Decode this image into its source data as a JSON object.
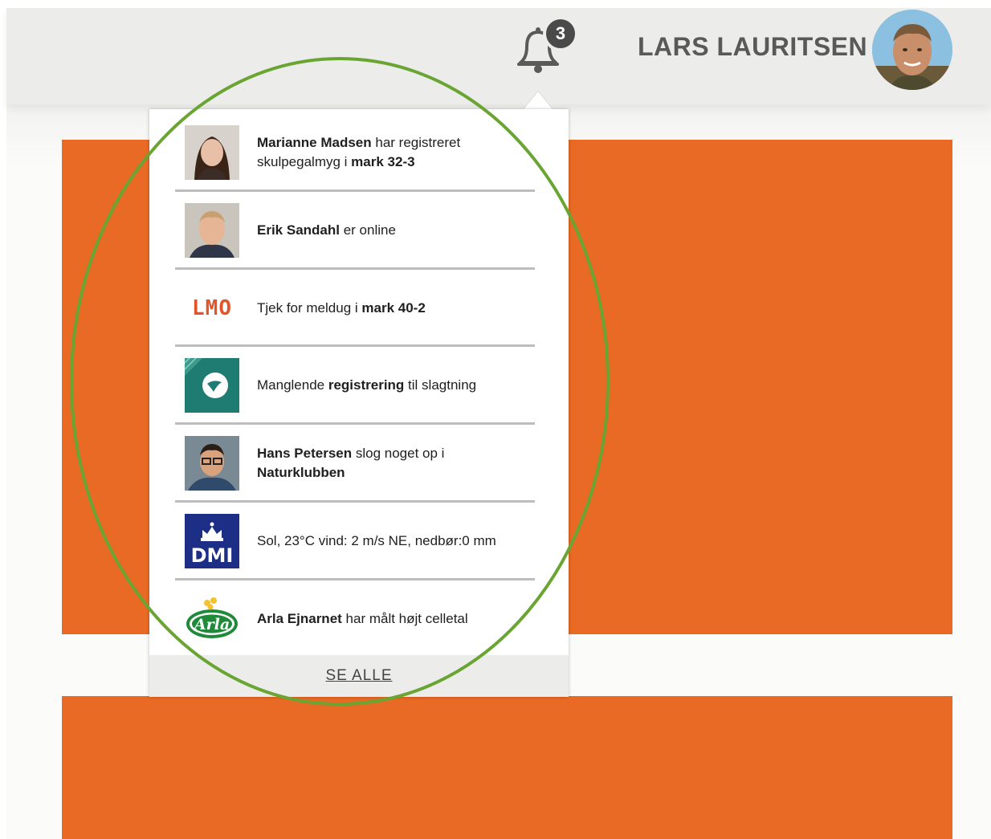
{
  "header": {
    "notification_count": "3",
    "user_name": "LARS LAURITSEN"
  },
  "notifications": [
    {
      "avatar": "woman-portrait",
      "name": "Marianne Madsen",
      "text_1": " har registreret skulpegalmyg i ",
      "bold_2": "mark 32-3",
      "text_2": ""
    },
    {
      "avatar": "man-portrait",
      "name": "Erik Sandahl",
      "text_1": " er online",
      "bold_2": "",
      "text_2": ""
    },
    {
      "avatar": "lmo-logo",
      "logo_text": "LMO",
      "name": "",
      "text_1": "Tjek for meldug i ",
      "bold_2": "mark 40-2",
      "text_2": ""
    },
    {
      "avatar": "seges-logo",
      "name": "",
      "text_1": "Manglende ",
      "bold_2": "registrering",
      "text_2": " til slagtning"
    },
    {
      "avatar": "man-glasses-portrait",
      "name": "Hans Petersen",
      "text_1": " slog noget op i ",
      "bold_2": "Naturklubben",
      "text_2": ""
    },
    {
      "avatar": "dmi-logo",
      "logo_text": "DMI",
      "name": "",
      "text_1": "Sol, 23°C vind: 2 m/s NE, nedbør:0 mm",
      "bold_2": "",
      "text_2": ""
    },
    {
      "avatar": "arla-logo",
      "logo_text": "Arla",
      "name": "Arla Ejnarnet",
      "text_1": " har målt højt celletal",
      "bold_2": "",
      "text_2": ""
    }
  ],
  "see_all_label": "SE ALLE",
  "colors": {
    "accent_orange": "#e86a24",
    "annotation_green": "#6aa534",
    "topbar": "#ececea"
  }
}
